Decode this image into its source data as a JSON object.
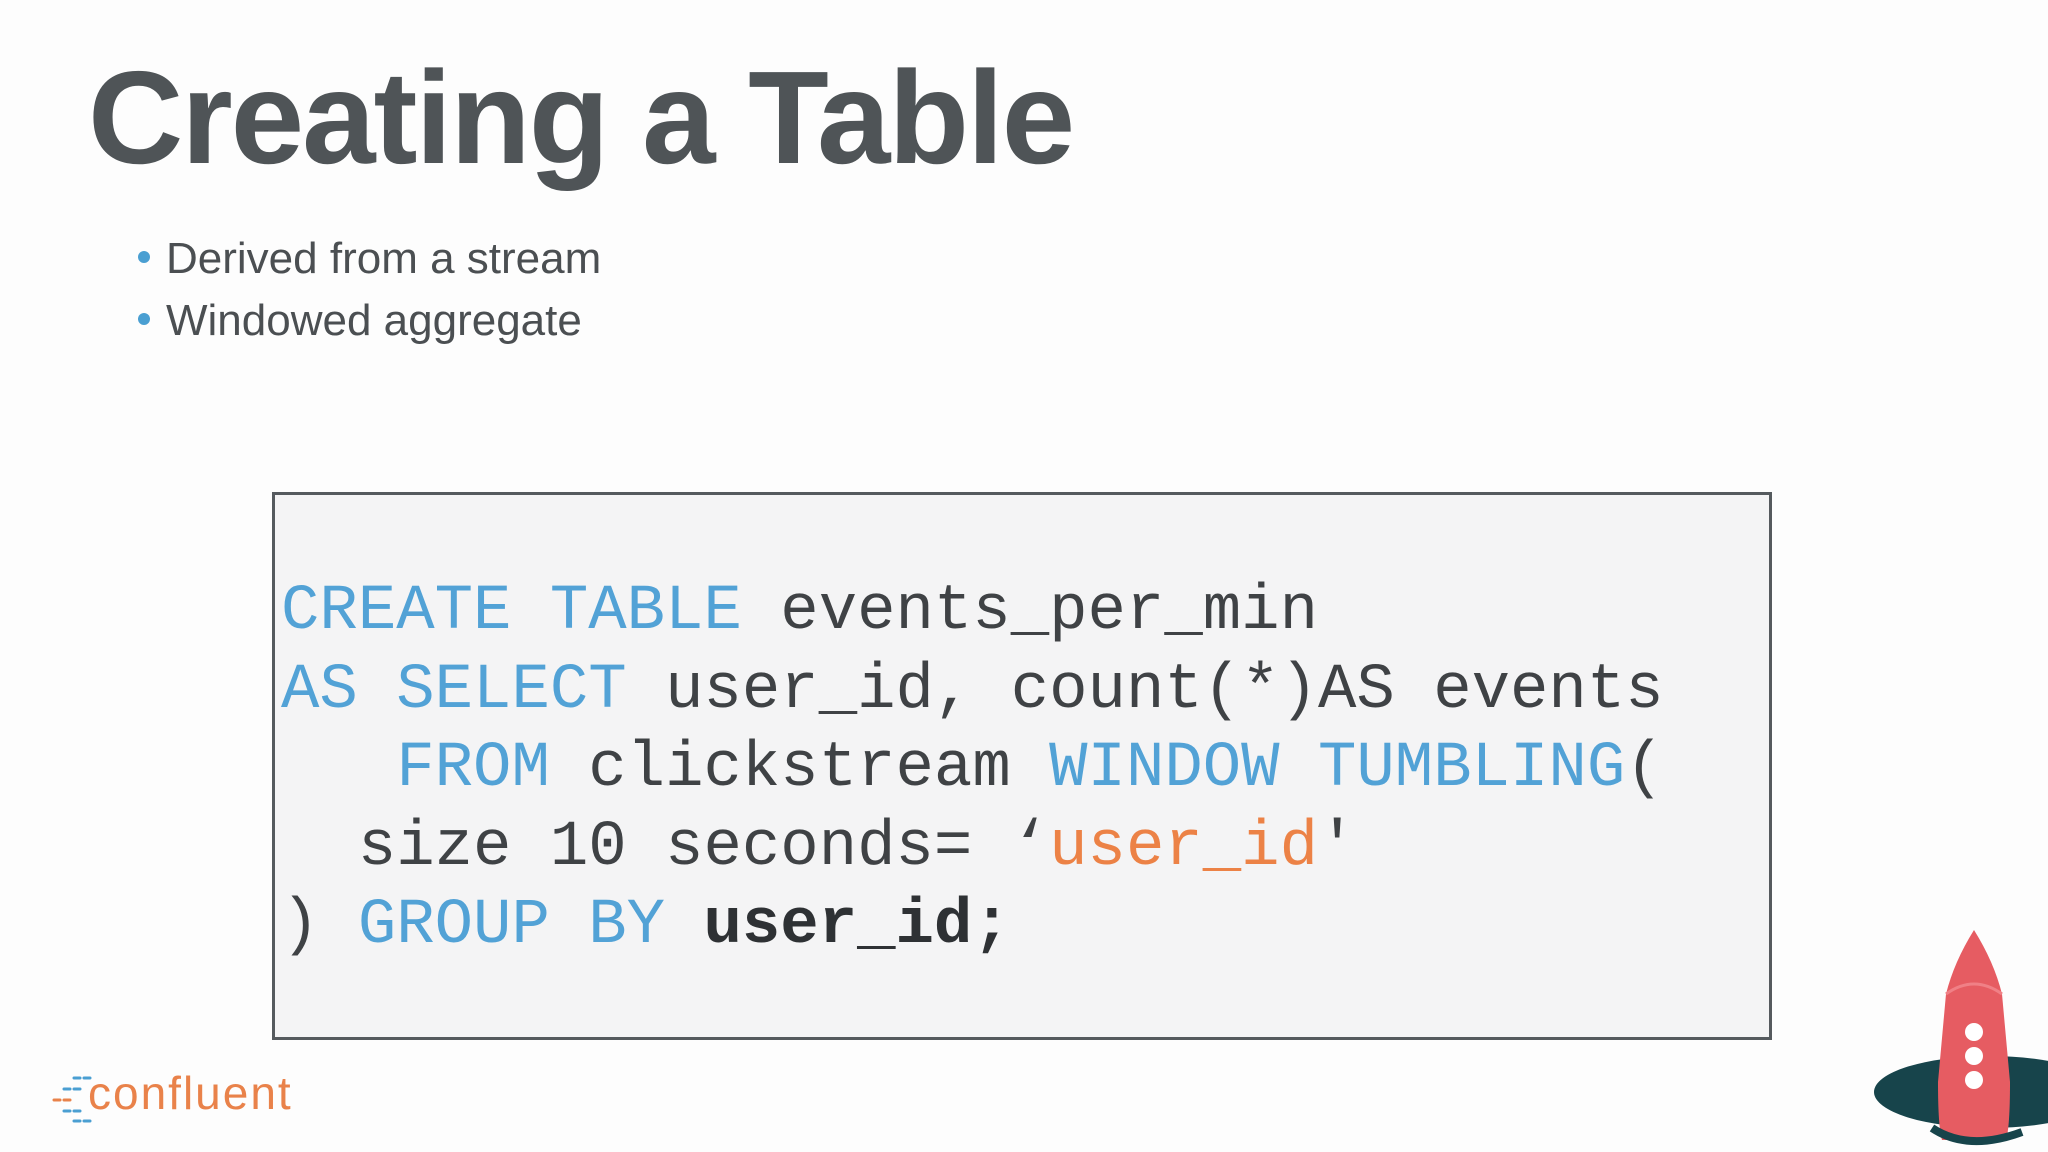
{
  "slide": {
    "title": "Creating a Table",
    "bullets": [
      "Derived from a stream",
      "Windowed aggregate"
    ]
  },
  "code": {
    "line1": {
      "kw1": "CREATE",
      "kw2": "TABLE",
      "ident": "events_per_min"
    },
    "line2": {
      "kw1": "AS",
      "kw2": "SELECT",
      "rest": "user_id, count(*)AS events"
    },
    "line3": {
      "kw1": "FROM",
      "ident": "clickstream",
      "kw2": "WINDOW",
      "kw3": "TUMBLING",
      "paren": "("
    },
    "line4": {
      "text": "size 10 seconds= ",
      "open_quote": "‘",
      "str": "user_id",
      "close_quote": "'"
    },
    "line5": {
      "paren": ")",
      "kw1": "GROUP",
      "kw2": "BY",
      "ident": "user_id;"
    }
  },
  "logo": {
    "text": "confluent"
  },
  "colors": {
    "title": "#4f5457",
    "keyword": "#52a2d6",
    "string": "#ec8246",
    "brand": "#e9824a",
    "rocket": "#e65c62"
  }
}
